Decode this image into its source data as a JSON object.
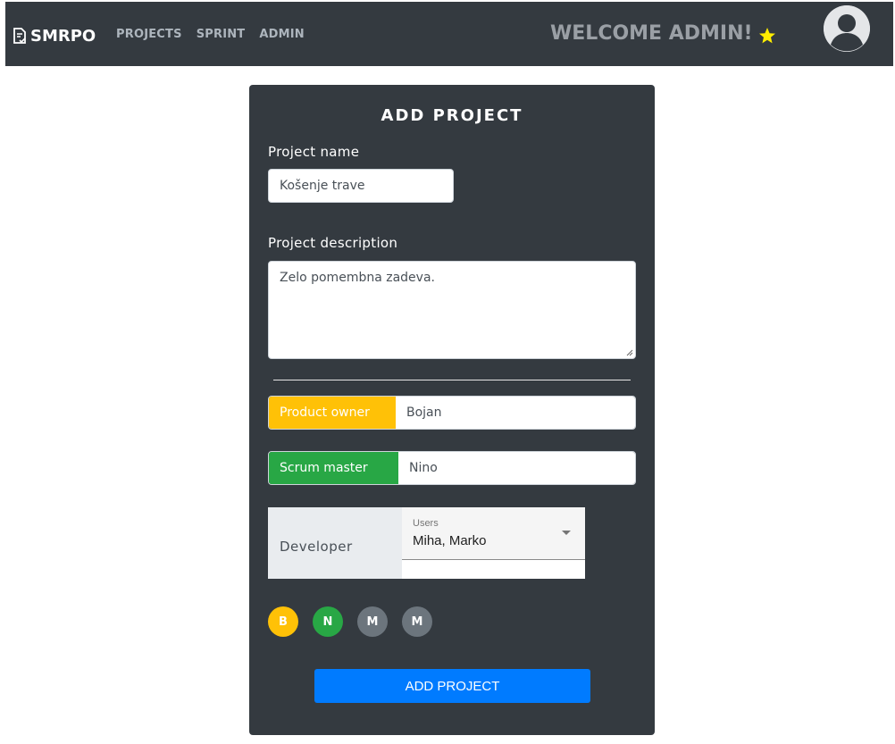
{
  "navbar": {
    "brand": "SMRPO",
    "links": [
      "PROJECTS",
      "SPRINT",
      "ADMIN"
    ],
    "welcome": "WELCOME ADMIN!",
    "welcome_icon": "star-icon",
    "avatar_icon": "user-avatar-icon"
  },
  "form": {
    "title": "ADD PROJECT",
    "name_label": "Project name",
    "name_value": "Košenje trave",
    "description_label": "Project description",
    "description_value": "Zelo pomembna zadeva.",
    "product_owner_label": "Product owner",
    "product_owner_value": "Bojan",
    "scrum_master_label": "Scrum master",
    "scrum_master_value": "Nino",
    "developer_label": "Developer",
    "developer_field_label": "Users",
    "developer_value": "Miha, Marko",
    "members": [
      {
        "initial": "B",
        "color": "#ffc107"
      },
      {
        "initial": "N",
        "color": "#28a745"
      },
      {
        "initial": "M",
        "color": "#6c757d"
      },
      {
        "initial": "M",
        "color": "#6c757d"
      }
    ],
    "submit_label": "ADD PROJECT"
  },
  "colors": {
    "navbar_bg": "#343a40",
    "card_bg": "#343a40",
    "product_owner": "#ffc107",
    "scrum_master": "#28a745",
    "primary": "#007bff",
    "star": "#ffd700"
  }
}
